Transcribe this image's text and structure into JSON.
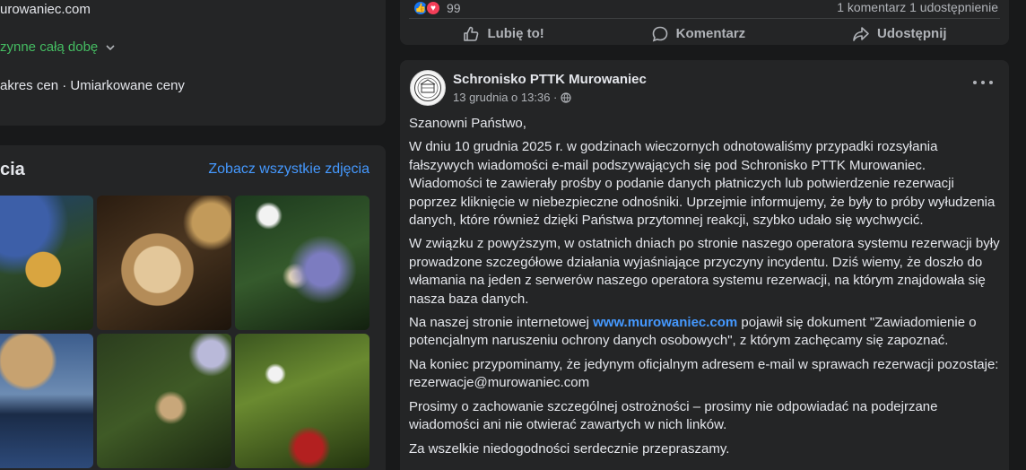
{
  "intro": {
    "website": "urowaniec.com",
    "hours": "zynne całą dobę",
    "price": "akres cen · Umiarkowane ceny"
  },
  "photos": {
    "title": "cia",
    "see_all": "Zobacz wszystkie zdjęcia"
  },
  "previous_post": {
    "reactions_count": "99",
    "comments": "1 komentarz",
    "shares": "1 udostępnienie",
    "actions": {
      "like": "Lubię to!",
      "comment": "Komentarz",
      "share": "Udostępnij"
    }
  },
  "post": {
    "author": "Schronisko PTTK Murowaniec",
    "date": "13 grudnia o 13:36 ·",
    "greeting": "Szanowni Państwo,",
    "p1": "W dniu 10 grudnia 2025 r. w godzinach wieczornych odnotowaliśmy przypadki rozsyłania fałszywych wiadomości e-mail podszywających się pod Schronisko PTTK Murowaniec. Wiadomości te zawierały prośby o podanie danych płatniczych lub potwierdzenie rezerwacji poprzez kliknięcie w niebezpieczne odnośniki. Uprzejmie informujemy, że były to próby wyłudzenia danych, które również dzięki Państwa przytomnej reakcji, szybko udało się wychwycić.",
    "p2": "W związku z powyższym, w ostatnich dniach po stronie naszego operatora systemu rezerwacji były prowadzone szczegółowe działania wyjaśniające przyczyny incydentu. Dziś wiemy, że doszło do włamania na jeden z serwerów naszego operatora systemu rezerwacji, na którym znajdowała się nasza baza danych.",
    "p3_before": "Na naszej stronie internetowej ",
    "p3_link": "www.murowaniec.com",
    "p3_after": " pojawił się dokument \"Zawiadomienie o potencjalnym naruszeniu ochrony danych osobowych\", z którym zachęcamy się zapoznać.",
    "p4": "Na koniec przypominamy, że jedynym oficjalnym adresem e-mail w sprawach rezerwacji pozostaje: rezerwacje@murowaniec.com",
    "p5": "Prosimy o zachowanie szczególnej ostrożności – prosimy nie odpowiadać na podejrzane wiadomości ani nie otwierać zawartych w nich linków.",
    "p6": "Za wszelkie niedogodności serdecznie przepraszamy."
  },
  "colors": {
    "background": "#18191a",
    "card": "#242526",
    "link": "#4599ff",
    "open_status": "#45bd62",
    "like": "#1877f2",
    "love": "#f33e58"
  }
}
